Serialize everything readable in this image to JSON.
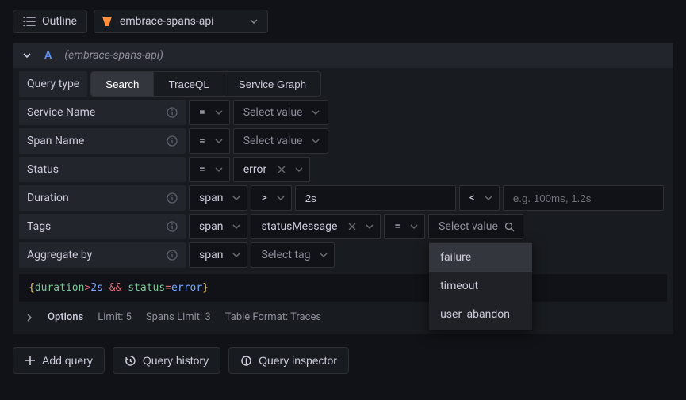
{
  "topbar": {
    "outline_label": "Outline",
    "datasource_name": "embrace-spans-api"
  },
  "query": {
    "ref_id": "A",
    "datasource_label": "(embrace-spans-api)",
    "type_label": "Query type",
    "types": {
      "search": "Search",
      "traceql": "TraceQL",
      "service_graph": "Service Graph"
    },
    "service_name": {
      "label": "Service Name",
      "op": "=",
      "value_placeholder": "Select value"
    },
    "span_name": {
      "label": "Span Name",
      "op": "=",
      "value_placeholder": "Select value"
    },
    "status": {
      "label": "Status",
      "op": "=",
      "value": "error"
    },
    "duration": {
      "label": "Duration",
      "scope": "span",
      "op1": ">",
      "val1": "2s",
      "op2": "<",
      "val2_placeholder": "e.g. 100ms, 1.2s"
    },
    "tags": {
      "label": "Tags",
      "scope": "span",
      "key": "statusMessage",
      "op": "=",
      "value_placeholder": "Select value",
      "suggestions": [
        "failure",
        "timeout",
        "user_abandon"
      ]
    },
    "aggregate": {
      "label": "Aggregate by",
      "scope": "span",
      "tag_placeholder": "Select tag"
    },
    "preview": {
      "open": "{",
      "close": "}",
      "dur_key": "duration",
      "dur_op": ">",
      "dur_val": "2s",
      "and": "&&",
      "st_key": "status",
      "st_op": "=",
      "st_val": "error"
    },
    "options": {
      "label": "Options",
      "limit": "Limit: 5",
      "spans_limit": "Spans Limit: 3",
      "table_format": "Table Format: Traces"
    }
  },
  "footer": {
    "add_query": "Add query",
    "query_history": "Query history",
    "query_inspector": "Query inspector"
  }
}
